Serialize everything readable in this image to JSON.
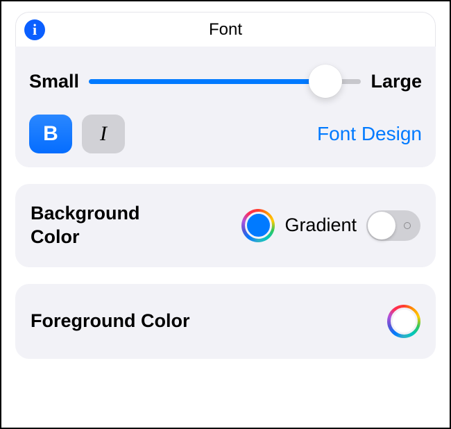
{
  "font": {
    "title": "Font",
    "sliderSmallLabel": "Small",
    "sliderLargeLabel": "Large",
    "sliderValue": 0.9,
    "boldGlyph": "B",
    "italicGlyph": "I",
    "boldActive": true,
    "italicActive": false,
    "fontDesignLabel": "Font Design"
  },
  "backgroundColor": {
    "label": "Background Color",
    "selectedColor": "#007AFF",
    "gradientLabel": "Gradient",
    "gradientEnabled": false
  },
  "foregroundColor": {
    "label": "Foreground Color",
    "selectedColor": "#FFFFFF"
  }
}
